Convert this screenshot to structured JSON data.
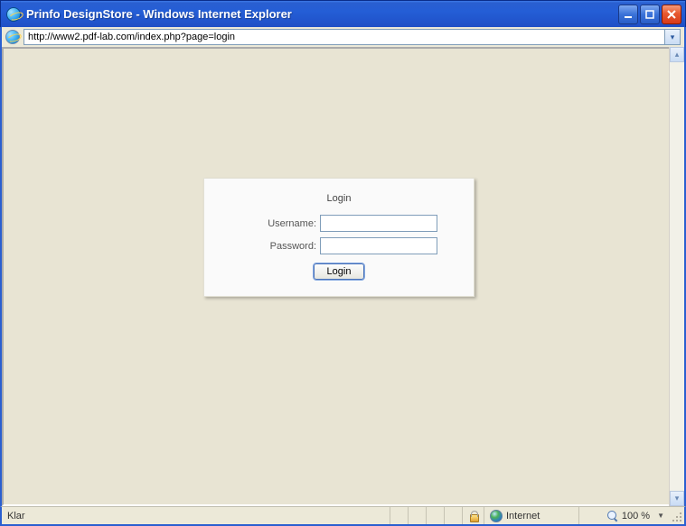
{
  "window": {
    "title": "Prinfo DesignStore - Windows Internet Explorer"
  },
  "address": {
    "url": "http://www2.pdf-lab.com/index.php?page=login"
  },
  "login": {
    "heading": "Login",
    "username_label": "Username:",
    "password_label": "Password:",
    "username_value": "",
    "password_value": "",
    "button_label": "Login"
  },
  "status": {
    "text": "Klar",
    "zone": "Internet",
    "zoom": "100 %"
  }
}
